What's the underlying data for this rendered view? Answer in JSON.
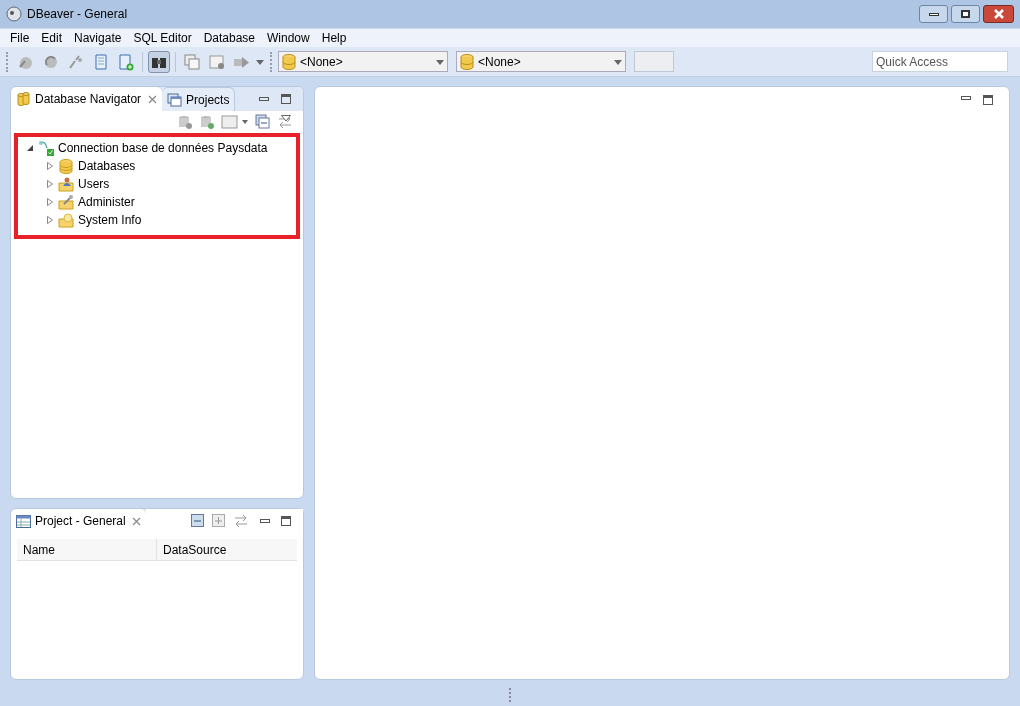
{
  "window": {
    "title": "DBeaver - General"
  },
  "menu": [
    "File",
    "Edit",
    "Navigate",
    "SQL Editor",
    "Database",
    "Window",
    "Help"
  ],
  "toolbar": {
    "pressed": [
      false,
      false,
      false,
      false,
      false,
      true,
      false,
      false,
      false
    ],
    "combos": [
      {
        "value": "<None>"
      },
      {
        "value": "<None>"
      }
    ],
    "quick_access": {
      "placeholder": "Quick Access"
    }
  },
  "navigator": {
    "tabs": [
      {
        "label": "Database Navigator",
        "selected": true
      },
      {
        "label": "Projects",
        "selected": false
      }
    ],
    "highlighted": true,
    "tree": [
      {
        "label": "Connection base de données Paysdata",
        "kind": "connection",
        "expanded": true,
        "children": [
          {
            "label": "Databases",
            "kind": "databases",
            "expanded": false
          },
          {
            "label": "Users",
            "kind": "users",
            "expanded": false
          },
          {
            "label": "Administer",
            "kind": "admin",
            "expanded": false
          },
          {
            "label": "System Info",
            "kind": "info",
            "expanded": false
          }
        ]
      }
    ]
  },
  "project": {
    "tab": {
      "label": "Project - General",
      "selected": true
    },
    "columns": [
      "Name",
      "DataSource"
    ]
  }
}
